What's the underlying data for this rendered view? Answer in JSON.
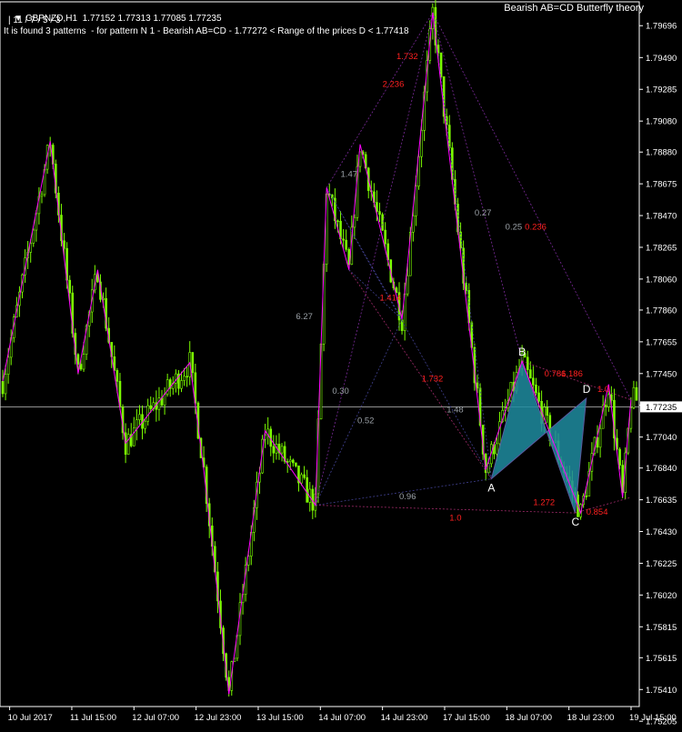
{
  "header": {
    "symbol_line": "GBPNZD,H1  1.77152 1.77313 1.77085 1.77235",
    "indicator_line": "11 / 7 / 5 / 3",
    "info_line": "It is found 3 patterns  - for pattern N 1 - Bearish AB=CD - 1.77272 < Range of the prices D < 1.77418",
    "indicator_title": "Bearish AB=CD Butterfly theory"
  },
  "colors": {
    "background": "#000000",
    "candle": "#7CFC00",
    "zigzag": "#FF00FF",
    "pattern_fill": "#1E8CA0",
    "ratio_gray": "#9AA0A6",
    "ratio_red": "#FF2020",
    "grid_axis": "#FFFFFF",
    "current_price_line": "#C0C0C0"
  },
  "chart_data": {
    "type": "candlestick",
    "symbol": "GBPNZD",
    "timeframe": "H1",
    "ylim": [
      1.753,
      1.7985
    ],
    "y_ticks": [
      "1.79696",
      "1.79490",
      "1.79285",
      "1.79080",
      "1.78880",
      "1.78675",
      "1.78470",
      "1.78265",
      "1.78060",
      "1.77860",
      "1.77655",
      "1.77450",
      "1.77245",
      "1.77040",
      "1.76840",
      "1.76635",
      "1.76430",
      "1.76225",
      "1.76020",
      "1.75815",
      "1.75615",
      "1.75410",
      "1.75205"
    ],
    "current_price": "1.77235",
    "x_ticks": [
      "10 Jul 2017",
      "11 Jul 15:00",
      "12 Jul 07:00",
      "12 Jul 23:00",
      "13 Jul 15:00",
      "14 Jul 07:00",
      "14 Jul 23:00",
      "17 Jul 15:00",
      "18 Jul 07:00",
      "18 Jul 23:00",
      "19 Jul 15:00"
    ],
    "zigzag_points": [
      {
        "bar": 0,
        "price": 1.774
      },
      {
        "bar": 17,
        "price": 1.7895
      },
      {
        "bar": 27,
        "price": 1.7745
      },
      {
        "bar": 34,
        "price": 1.7812
      },
      {
        "bar": 44,
        "price": 1.77
      },
      {
        "bar": 67,
        "price": 1.7752
      },
      {
        "bar": 72,
        "price": 1.7683
      },
      {
        "bar": 81,
        "price": 1.7538
      },
      {
        "bar": 94,
        "price": 1.7708
      },
      {
        "bar": 112,
        "price": 1.766
      },
      {
        "bar": 116,
        "price": 1.7865
      },
      {
        "bar": 124,
        "price": 1.7812
      },
      {
        "bar": 128,
        "price": 1.7893
      },
      {
        "bar": 143,
        "price": 1.778
      },
      {
        "bar": 154,
        "price": 1.7978
      },
      {
        "bar": 173,
        "price": 1.7683
      },
      {
        "bar": 186,
        "price": 1.7753
      },
      {
        "bar": 207,
        "price": 1.7655
      },
      {
        "bar": 217,
        "price": 1.7738
      },
      {
        "bar": 222,
        "price": 1.7665
      },
      {
        "bar": 225,
        "price": 1.7728
      }
    ],
    "pattern_points": [
      {
        "label": "A",
        "bar": 175,
        "price": 1.7677
      },
      {
        "label": "B",
        "bar": 186,
        "price": 1.7753
      },
      {
        "label": "C",
        "bar": 205,
        "price": 1.7655
      },
      {
        "label": "D",
        "bar": 209,
        "price": 1.7729
      }
    ],
    "ratio_labels": [
      {
        "text": "1.732",
        "color": "red",
        "bar": 141,
        "price": 1.7948
      },
      {
        "text": "2.236",
        "color": "red",
        "bar": 136,
        "price": 1.793
      },
      {
        "text": "1.47",
        "color": "gray",
        "bar": 121,
        "price": 1.7872
      },
      {
        "text": "6.27",
        "color": "gray",
        "bar": 105,
        "price": 1.778
      },
      {
        "text": "1.414",
        "color": "red",
        "bar": 135,
        "price": 1.7792
      },
      {
        "text": "0.27",
        "color": "gray",
        "bar": 169,
        "price": 1.7847
      },
      {
        "text": "0.25",
        "color": "gray",
        "bar": 180,
        "price": 1.7838
      },
      {
        "text": "0.236",
        "color": "red",
        "bar": 187,
        "price": 1.7838
      },
      {
        "text": "0.30",
        "color": "gray",
        "bar": 118,
        "price": 1.7732
      },
      {
        "text": "1.732",
        "color": "red",
        "bar": 150,
        "price": 1.774
      },
      {
        "text": "0.52",
        "color": "gray",
        "bar": 127,
        "price": 1.7713
      },
      {
        "text": "1.48",
        "color": "gray",
        "bar": 159,
        "price": 1.772
      },
      {
        "text": "0.786",
        "color": "red",
        "bar": 194,
        "price": 1.7743
      },
      {
        "text": "1.186",
        "color": "red",
        "bar": 200,
        "price": 1.7743
      },
      {
        "text": "1.0",
        "color": "red",
        "bar": 213,
        "price": 1.7733
      },
      {
        "text": "0.96",
        "color": "gray",
        "bar": 142,
        "price": 1.7664
      },
      {
        "text": "1.272",
        "color": "red",
        "bar": 190,
        "price": 1.766
      },
      {
        "text": "1.0",
        "color": "red",
        "bar": 160,
        "price": 1.765
      },
      {
        "text": "0.854",
        "color": "red",
        "bar": 209,
        "price": 1.7654
      }
    ]
  }
}
